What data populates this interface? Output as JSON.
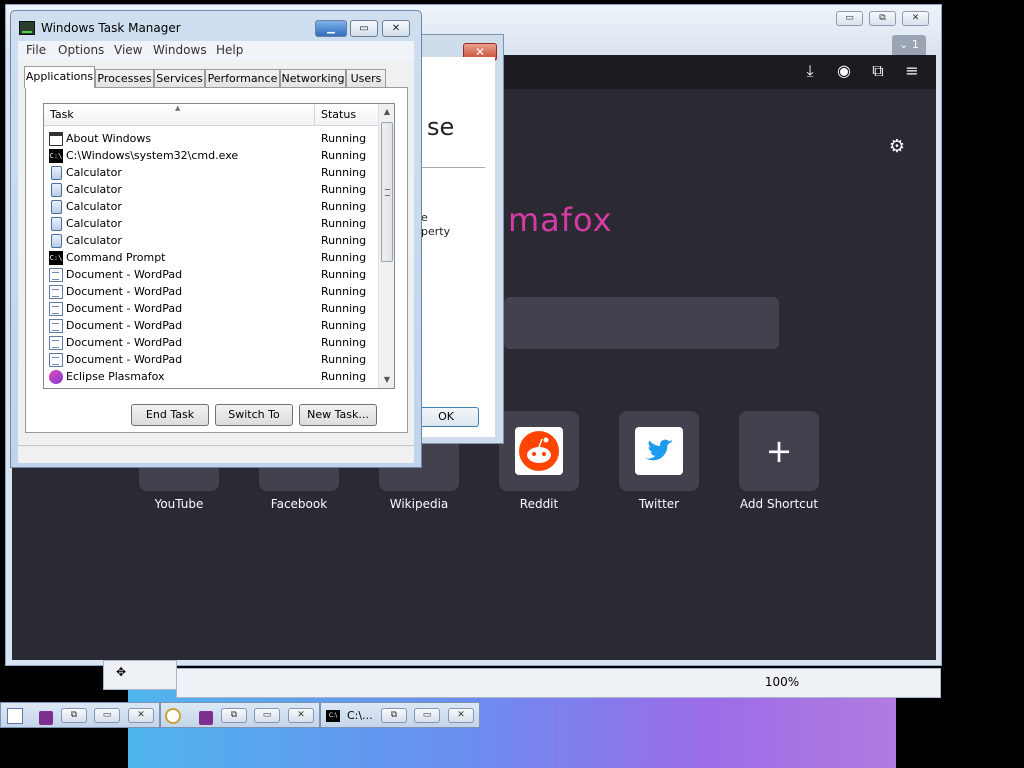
{
  "browser": {
    "tab_count": "1",
    "window_controls": [
      "▭",
      "⧉",
      "✕"
    ],
    "brand_fragment": "mafox",
    "brand_color": "#d43ca3",
    "shortcuts": [
      {
        "label": "YouTube"
      },
      {
        "label": "Facebook"
      },
      {
        "label": "Wikipedia"
      },
      {
        "label": "Reddit"
      },
      {
        "label": "Twitter"
      },
      {
        "label": "Add Shortcut"
      }
    ],
    "zoom": "100%"
  },
  "about_dialog": {
    "big_fragment": "se",
    "line1": "e",
    "line2": "perty",
    "ok_label": "OK",
    "close_label": "✕"
  },
  "task_manager": {
    "title": "Windows Task Manager",
    "menu": [
      "File",
      "Options",
      "View",
      "Windows",
      "Help"
    ],
    "tabs": [
      "Applications",
      "Processes",
      "Services",
      "Performance",
      "Networking",
      "Users"
    ],
    "columns": {
      "task": "Task",
      "status": "Status"
    },
    "rows": [
      {
        "icon": "window-icon",
        "task": "About Windows",
        "status": "Running"
      },
      {
        "icon": "cmd-icon",
        "task": "C:\\Windows\\system32\\cmd.exe",
        "status": "Running"
      },
      {
        "icon": "calculator-icon",
        "task": "Calculator",
        "status": "Running"
      },
      {
        "icon": "calculator-icon",
        "task": "Calculator",
        "status": "Running"
      },
      {
        "icon": "calculator-icon",
        "task": "Calculator",
        "status": "Running"
      },
      {
        "icon": "calculator-icon",
        "task": "Calculator",
        "status": "Running"
      },
      {
        "icon": "calculator-icon",
        "task": "Calculator",
        "status": "Running"
      },
      {
        "icon": "cmd-icon",
        "task": "Command Prompt",
        "status": "Running"
      },
      {
        "icon": "wordpad-icon",
        "task": "Document - WordPad",
        "status": "Running"
      },
      {
        "icon": "wordpad-icon",
        "task": "Document - WordPad",
        "status": "Running"
      },
      {
        "icon": "wordpad-icon",
        "task": "Document - WordPad",
        "status": "Running"
      },
      {
        "icon": "wordpad-icon",
        "task": "Document - WordPad",
        "status": "Running"
      },
      {
        "icon": "wordpad-icon",
        "task": "Document - WordPad",
        "status": "Running"
      },
      {
        "icon": "wordpad-icon",
        "task": "Document - WordPad",
        "status": "Running"
      },
      {
        "icon": "plasmafox-icon",
        "task": "Eclipse Plasmafox",
        "status": "Running"
      }
    ],
    "buttons": {
      "end_task": "End Task",
      "switch_to": "Switch To",
      "new_task": "New Task..."
    }
  },
  "taskbar": {
    "cmd_label": "C:\\..."
  }
}
